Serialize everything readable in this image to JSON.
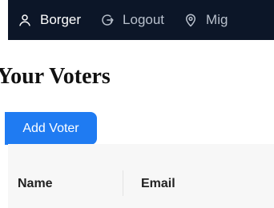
{
  "navbar": {
    "background": "#0c1628",
    "items": [
      {
        "label": "Borger",
        "icon": "user-icon"
      },
      {
        "label": "Logout",
        "icon": "logout-icon"
      },
      {
        "label": "Mig",
        "icon": "location-pin-icon"
      }
    ]
  },
  "page": {
    "title": "Your Voters"
  },
  "actions": {
    "add_voter_label": "Add Voter",
    "accent": "#1f7bf2"
  },
  "table": {
    "columns": [
      "Name",
      "Email"
    ]
  }
}
